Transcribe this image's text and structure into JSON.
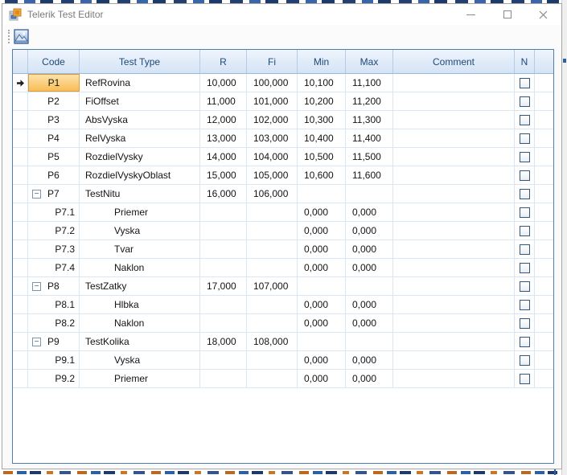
{
  "window": {
    "title": "Telerik Test Editor",
    "caption_buttons": [
      "minimize",
      "maximize",
      "close"
    ]
  },
  "toolbar": {
    "buttons": [
      {
        "name": "image-button",
        "icon": "picture-icon"
      }
    ]
  },
  "grid": {
    "collapse_glyph": "−",
    "columns": [
      {
        "key": "code",
        "label": "Code"
      },
      {
        "key": "testType",
        "label": "Test Type"
      },
      {
        "key": "r",
        "label": "R"
      },
      {
        "key": "fi",
        "label": "Fi"
      },
      {
        "key": "min",
        "label": "Min"
      },
      {
        "key": "max",
        "label": "Max"
      },
      {
        "key": "comment",
        "label": "Comment"
      },
      {
        "key": "n",
        "label": "N"
      }
    ],
    "rows": [
      {
        "code": "P1",
        "testType": "RefRovina",
        "r": "10,000",
        "fi": "100,000",
        "min": "10,100",
        "max": "11,100",
        "comment": "",
        "n": false,
        "level": 0,
        "expandable": false,
        "current": true,
        "selectedCell": "code"
      },
      {
        "code": "P2",
        "testType": "FiOffset",
        "r": "11,000",
        "fi": "101,000",
        "min": "10,200",
        "max": "11,200",
        "comment": "",
        "n": false,
        "level": 0,
        "expandable": false,
        "current": false
      },
      {
        "code": "P3",
        "testType": "AbsVyska",
        "r": "12,000",
        "fi": "102,000",
        "min": "10,300",
        "max": "11,300",
        "comment": "",
        "n": false,
        "level": 0,
        "expandable": false,
        "current": false
      },
      {
        "code": "P4",
        "testType": "RelVyska",
        "r": "13,000",
        "fi": "103,000",
        "min": "10,400",
        "max": "11,400",
        "comment": "",
        "n": false,
        "level": 0,
        "expandable": false,
        "current": false
      },
      {
        "code": "P5",
        "testType": "RozdielVysky",
        "r": "14,000",
        "fi": "104,000",
        "min": "10,500",
        "max": "11,500",
        "comment": "",
        "n": false,
        "level": 0,
        "expandable": false,
        "current": false
      },
      {
        "code": "P6",
        "testType": "RozdielVyskyOblast",
        "r": "15,000",
        "fi": "105,000",
        "min": "10,600",
        "max": "11,600",
        "comment": "",
        "n": false,
        "level": 0,
        "expandable": false,
        "current": false
      },
      {
        "code": "P7",
        "testType": "TestNitu",
        "r": "16,000",
        "fi": "106,000",
        "min": "",
        "max": "",
        "comment": "",
        "n": false,
        "level": 0,
        "expandable": true,
        "expanded": true,
        "current": false
      },
      {
        "code": "P7.1",
        "testType": "Priemer",
        "r": "",
        "fi": "",
        "min": "0,000",
        "max": "0,000",
        "comment": "",
        "n": false,
        "level": 1,
        "expandable": false,
        "current": false
      },
      {
        "code": "P7.2",
        "testType": "Vyska",
        "r": "",
        "fi": "",
        "min": "0,000",
        "max": "0,000",
        "comment": "",
        "n": false,
        "level": 1,
        "expandable": false,
        "current": false
      },
      {
        "code": "P7.3",
        "testType": "Tvar",
        "r": "",
        "fi": "",
        "min": "0,000",
        "max": "0,000",
        "comment": "",
        "n": false,
        "level": 1,
        "expandable": false,
        "current": false
      },
      {
        "code": "P7.4",
        "testType": "Naklon",
        "r": "",
        "fi": "",
        "min": "0,000",
        "max": "0,000",
        "comment": "",
        "n": false,
        "level": 1,
        "expandable": false,
        "current": false
      },
      {
        "code": "P8",
        "testType": "TestZatky",
        "r": "17,000",
        "fi": "107,000",
        "min": "",
        "max": "",
        "comment": "",
        "n": false,
        "level": 0,
        "expandable": true,
        "expanded": true,
        "current": false
      },
      {
        "code": "P8.1",
        "testType": "Hlbka",
        "r": "",
        "fi": "",
        "min": "0,000",
        "max": "0,000",
        "comment": "",
        "n": false,
        "level": 1,
        "expandable": false,
        "current": false
      },
      {
        "code": "P8.2",
        "testType": "Naklon",
        "r": "",
        "fi": "",
        "min": "0,000",
        "max": "0,000",
        "comment": "",
        "n": false,
        "level": 1,
        "expandable": false,
        "current": false
      },
      {
        "code": "P9",
        "testType": "TestKolika",
        "r": "18,000",
        "fi": "108,000",
        "min": "",
        "max": "",
        "comment": "",
        "n": false,
        "level": 0,
        "expandable": true,
        "expanded": true,
        "current": false
      },
      {
        "code": "P9.1",
        "testType": "Vyska",
        "r": "",
        "fi": "",
        "min": "0,000",
        "max": "0,000",
        "comment": "",
        "n": false,
        "level": 1,
        "expandable": false,
        "current": false
      },
      {
        "code": "P9.2",
        "testType": "Priemer",
        "r": "",
        "fi": "",
        "min": "0,000",
        "max": "0,000",
        "comment": "",
        "n": false,
        "level": 1,
        "expandable": false,
        "current": false
      }
    ]
  },
  "colors": {
    "selection_orange": "#F7BD55",
    "selection_border": "#DE9B3D",
    "header_text": "#1D4978",
    "header_bg": "#D4E3F5",
    "grid_line": "#D9E6F4",
    "grid_border": "#4F7DAF",
    "checkbox_border": "#30587E",
    "title_text": "#7A7A7A"
  }
}
